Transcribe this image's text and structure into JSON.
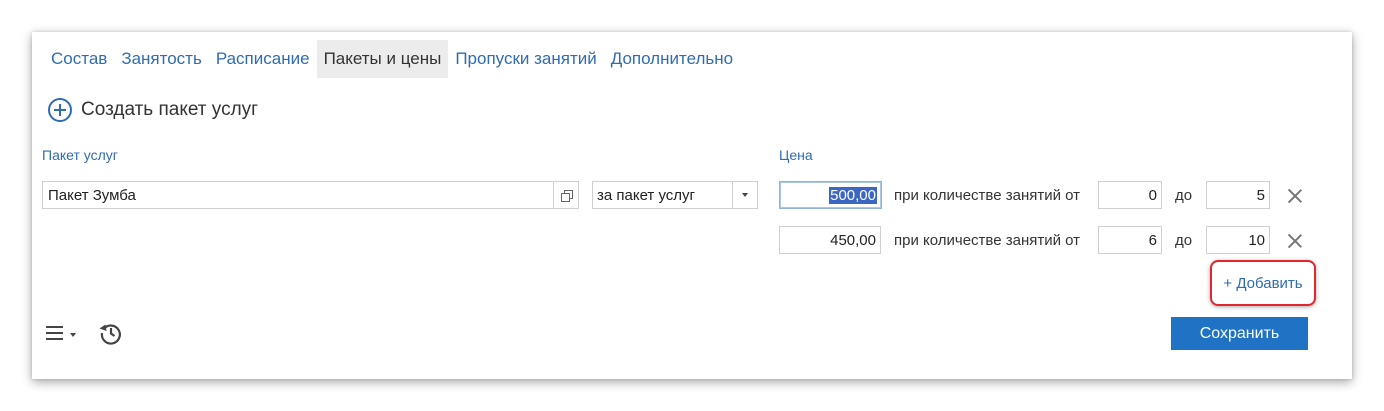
{
  "tabs": [
    {
      "label": "Состав",
      "active": false
    },
    {
      "label": "Занятость",
      "active": false
    },
    {
      "label": "Расписание",
      "active": false
    },
    {
      "label": "Пакеты и цены",
      "active": true
    },
    {
      "label": "Пропуски занятий",
      "active": false
    },
    {
      "label": "Дополнительно",
      "active": false
    }
  ],
  "create_package": {
    "label": "Создать пакет услуг",
    "icon": "plus-circle-icon"
  },
  "columns": {
    "package": "Пакет услуг",
    "price": "Цена"
  },
  "package_field": {
    "value": "Пакет Зумба",
    "icon": "open-external-icon"
  },
  "pricing_mode": {
    "selected": "за пакет услуг"
  },
  "price_rows": [
    {
      "price": "500,00",
      "from_label": "при количестве занятий от",
      "from": "0",
      "to_label": "до",
      "to": "5"
    },
    {
      "price": "450,00",
      "from_label": "при количестве занятий от",
      "from": "6",
      "to_label": "до",
      "to": "10"
    }
  ],
  "add_link": "+ Добавить",
  "footer": {
    "menu_icon": "hamburger-menu-icon",
    "history_icon": "history-icon",
    "save_label": "Сохранить"
  },
  "colors": {
    "accent": "#2f6cb3",
    "save_button": "#1f72c4",
    "highlight": "#e0272b",
    "selection": "#3b66c4"
  }
}
